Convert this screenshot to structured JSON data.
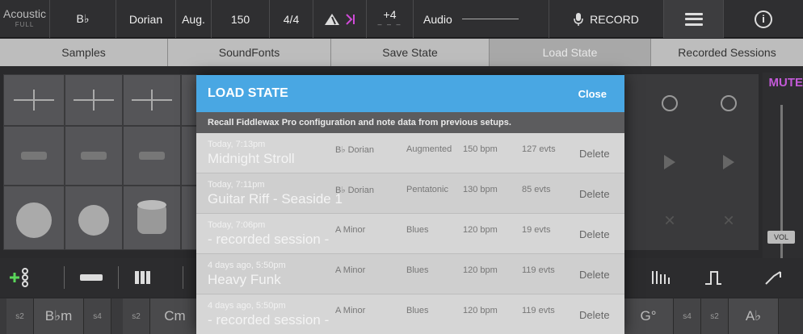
{
  "topbar": {
    "logo_main": "Acoustic",
    "logo_sub": "FULL",
    "key": "B♭",
    "mode": "Dorian",
    "chord": "Aug.",
    "tempo": "150",
    "meter": "4/4",
    "transpose": "+4",
    "transpose_dash": "– – –",
    "audio": "Audio",
    "record": "RECORD",
    "info": "i"
  },
  "tabs": [
    {
      "label": "Samples"
    },
    {
      "label": "SoundFonts"
    },
    {
      "label": "Save State"
    },
    {
      "label": "Load State"
    },
    {
      "label": "Recorded Sessions"
    }
  ],
  "mute_label": "MUTE",
  "vol_label": "VOL",
  "modal": {
    "title": "LOAD STATE",
    "close": "Close",
    "subtitle": "Recall Fiddlewax Pro configuration and note data from previous setups.",
    "rows": [
      {
        "when": "Today, 7:13pm",
        "name": "Midnight Stroll",
        "key": "B♭ Dorian",
        "scale": "Augmented",
        "bpm": "150 bpm",
        "evts": "127 evts",
        "delete": "Delete"
      },
      {
        "when": "Today, 7:11pm",
        "name": "Guitar Riff - Seaside 1",
        "key": "B♭ Dorian",
        "scale": "Pentatonic",
        "bpm": "130 bpm",
        "evts": "85 evts",
        "delete": "Delete"
      },
      {
        "when": "Today, 7:06pm",
        "name": "- recorded session -",
        "key": "A Minor",
        "scale": "Blues",
        "bpm": "120 bpm",
        "evts": "19 evts",
        "delete": "Delete"
      },
      {
        "when": "4 days ago, 5:50pm",
        "name": "Heavy Funk",
        "key": "A Minor",
        "scale": "Blues",
        "bpm": "120 bpm",
        "evts": "119 evts",
        "delete": "Delete"
      },
      {
        "when": "4 days ago, 5:50pm",
        "name": "- recorded session -",
        "key": "A Minor",
        "scale": "Blues",
        "bpm": "120 bpm",
        "evts": "119 evts",
        "delete": "Delete"
      }
    ]
  },
  "chords": {
    "s2a": "s2",
    "bbm": "B♭m",
    "s4a": "s4",
    "s2b": "s2",
    "cm": "Cm",
    "g": "G°",
    "s4b": "s4",
    "s2c": "s2",
    "ab": "A♭"
  }
}
